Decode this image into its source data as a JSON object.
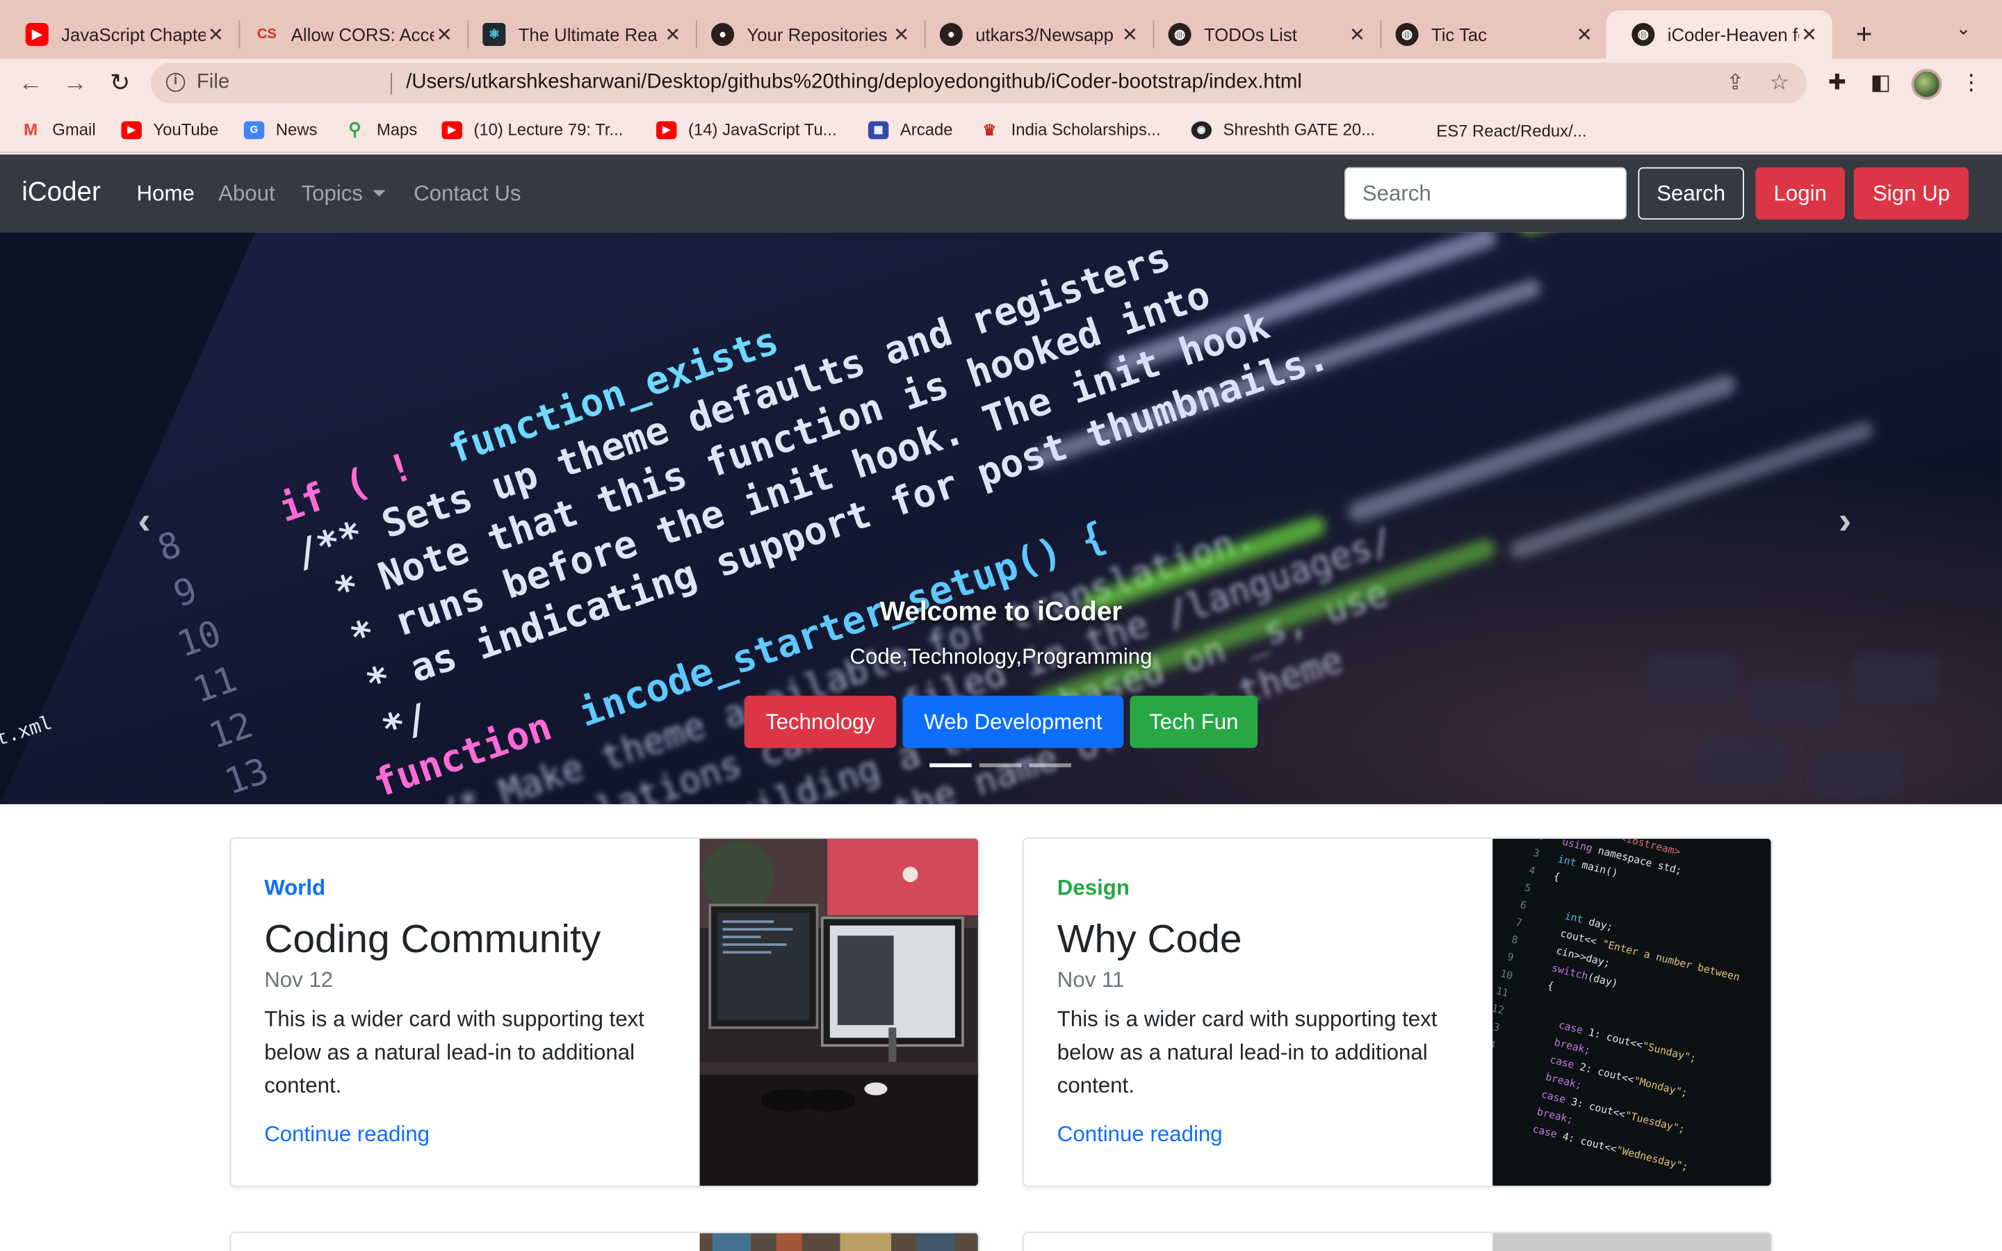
{
  "browser": {
    "tabs": [
      {
        "title": "JavaScript Chapte",
        "icon": "youtube-icon",
        "color": "#ff0000"
      },
      {
        "title": "Allow CORS: Acce",
        "icon": "extension-cors-icon",
        "color": "#c0392b"
      },
      {
        "title": "The Ultimate Rea",
        "icon": "react-icon",
        "color": "#222222"
      },
      {
        "title": "Your Repositories",
        "icon": "github-icon",
        "color": "#222222"
      },
      {
        "title": "utkars3/Newsapp",
        "icon": "github-icon",
        "color": "#222222"
      },
      {
        "title": "TODOs List",
        "icon": "globe-icon",
        "color": "#222222"
      },
      {
        "title": "Tic Tac",
        "icon": "globe-icon",
        "color": "#222222"
      },
      {
        "title": "iCoder-Heaven fo",
        "icon": "globe-icon",
        "color": "#222222"
      }
    ],
    "active_tab": 7,
    "address": {
      "scheme_label": "File",
      "url": "/Users/utkarshkesharwani/Desktop/githubs%20thing/deployedongithub/iCoder-bootstrap/index.html"
    },
    "bookmarks": [
      {
        "label": "Gmail",
        "icon": "gmail-icon",
        "color": "#ea4335"
      },
      {
        "label": "YouTube",
        "icon": "youtube-icon",
        "color": "#ff0000"
      },
      {
        "label": "News",
        "icon": "news-icon",
        "color": "#4285f4"
      },
      {
        "label": "Maps",
        "icon": "maps-icon",
        "color": "#34a853"
      },
      {
        "label": "(10) Lecture 79: Tr...",
        "icon": "youtube-icon",
        "color": "#ff0000"
      },
      {
        "label": "(14) JavaScript Tu...",
        "icon": "youtube-icon",
        "color": "#ff0000"
      },
      {
        "label": "Arcade",
        "icon": "arcade-icon",
        "color": "#3949ab"
      },
      {
        "label": "India Scholarships...",
        "icon": "scholarship-icon",
        "color": "#c62828"
      },
      {
        "label": "Shreshth GATE 20...",
        "icon": "gate-icon",
        "color": "#222222"
      },
      {
        "label": "ES7 React/Redux/...",
        "icon": "microsoft-icon",
        "color": "#f25022"
      }
    ]
  },
  "site": {
    "brand": "iCoder",
    "nav": [
      "Home",
      "About",
      "Topics",
      "Contact Us"
    ],
    "search_placeholder": "Search",
    "search_button": "Search",
    "login_button": "Login",
    "signup_button": "Sign Up",
    "accent": "#dc3545"
  },
  "carousel": {
    "title": "Welcome to iCoder",
    "subtitle": "Code,Technology,Programming",
    "buttons": [
      {
        "label": "Technology",
        "color": "#dc3545"
      },
      {
        "label": "Web Development",
        "color": "#0d6efd"
      },
      {
        "label": "Tech Fun",
        "color": "#28a745"
      }
    ],
    "slide_count": 3,
    "active_slide": 1,
    "prev_icon": "chevron-left-icon",
    "next_icon": "chevron-right-icon"
  },
  "cards": [
    {
      "category": "World",
      "category_color": "#0d6efd",
      "title": "Coding Community",
      "date": "Nov 12",
      "text": "This is a wider card with supporting text below as a natural lead-in to additional content.",
      "link": "Continue reading"
    },
    {
      "category": "Design",
      "category_color": "#28a745",
      "title": "Why Code",
      "date": "Nov 11",
      "text": "This is a wider card with supporting text below as a natural lead-in to additional content.",
      "link": "Continue reading"
    }
  ]
}
